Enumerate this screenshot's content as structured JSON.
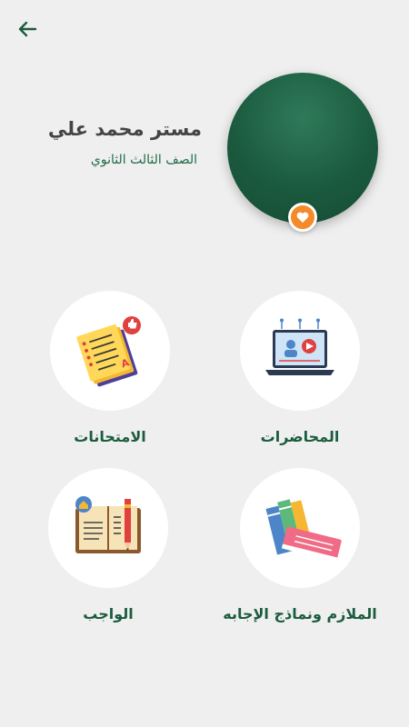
{
  "header": {
    "back_icon": "arrow-left-icon"
  },
  "profile": {
    "name": "مستر محمد علي",
    "grade": "الصف الثالث الثانوي",
    "badge_icon": "heart-icon",
    "avatar_color": "#1b5a3e",
    "badge_color": "#f58a28"
  },
  "menu": [
    {
      "label": "المحاضرات",
      "icon": "laptop-video-icon"
    },
    {
      "label": "الامتحانات",
      "icon": "exam-papers-icon"
    },
    {
      "label": "الملازم ونماذج الإجابه",
      "icon": "books-icon"
    },
    {
      "label": "الواجب",
      "icon": "homework-notebook-icon"
    }
  ],
  "colors": {
    "accent": "#1c5c3e",
    "background": "#efefef"
  }
}
